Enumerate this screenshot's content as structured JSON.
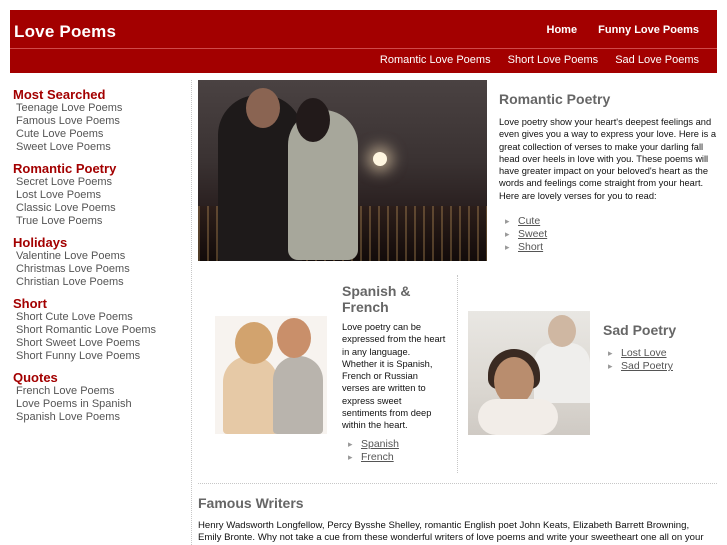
{
  "header": {
    "title": "Love Poems",
    "nav_top": [
      "Home",
      "Funny Love Poems"
    ],
    "nav_sub": [
      "Romantic Love Poems",
      "Short Love Poems",
      "Sad Love Poems"
    ]
  },
  "sidebar": {
    "sections": [
      {
        "heading": "Most Searched",
        "links": [
          "Teenage Love Poems",
          "Famous Love Poems",
          "Cute Love Poems",
          "Sweet Love Poems"
        ]
      },
      {
        "heading": "Romantic Poetry",
        "links": [
          "Secret Love Poems",
          "Lost Love Poems",
          "Classic Love Poems",
          "True Love Poems"
        ]
      },
      {
        "heading": "Holidays",
        "links": [
          "Valentine Love Poems",
          "Christmas Love Poems",
          "Christian Love Poems"
        ]
      },
      {
        "heading": "Short",
        "links": [
          "Short Cute Love Poems",
          "Short Romantic Love Poems",
          "Short Sweet Love Poems",
          "Short Funny Love Poems"
        ]
      },
      {
        "heading": "Quotes",
        "links": [
          "French Love Poems",
          "Love Poems in Spanish",
          "Spanish Love Poems"
        ]
      }
    ]
  },
  "romantic": {
    "title": "Romantic Poetry",
    "text": "Love poetry show your heart's deepest feelings and even gives you a way to express your love. Here is a great collection of verses to make your darling fall head over heels in love with you. These poems will have greater impact on your beloved's heart as the words and feelings come straight from your heart. Here are lovely verses for you to read:",
    "links": [
      "Cute",
      "Sweet",
      "Short"
    ]
  },
  "spanish": {
    "title": "Spanish & French",
    "text": "Love poetry can be expressed from the heart in any language. Whether it is Spanish, French or Russian verses are written to express sweet sentiments from deep within the heart.",
    "links": [
      "Spanish",
      "French"
    ]
  },
  "sad": {
    "title": "Sad Poetry",
    "links": [
      "Lost Love",
      "Sad Poetry"
    ]
  },
  "famous": {
    "title": "Famous Writers",
    "text": "Henry Wadsworth Longfellow, Percy Bysshe Shelley, romantic English poet John Keats, Elizabeth Barrett Browning, Emily Bronte. Why not take a cue from these wonderful writers of love poems and write your sweetheart one all on your own. It's"
  }
}
